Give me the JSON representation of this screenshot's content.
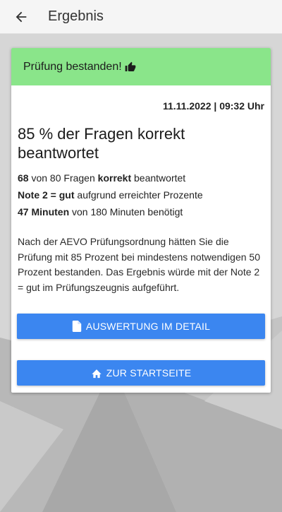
{
  "appbar": {
    "back_icon": "arrow-back-icon",
    "title": "Ergebnis"
  },
  "result": {
    "banner_text": "Prüfung bestanden!",
    "banner_icon": "thumbs-up-icon",
    "banner_color": "#8ae58a",
    "date": "11.11.2022",
    "separator": "|",
    "time": "09:32 Uhr",
    "headline": "85 % der Fragen korrekt beantwortet",
    "stats": {
      "correct_count": "68",
      "correct_mid": "von 80 Fragen",
      "correct_bold": "korrekt",
      "correct_tail": "beantwortet",
      "grade_bold": "Note 2 = gut",
      "grade_tail": "aufgrund erreichter Prozente",
      "minutes_bold": "47 Minuten",
      "minutes_tail": "von 180 Minuten benötigt"
    },
    "description": "Nach der AEVO Prüfungsordnung hätten Sie die Prüfung mit 85 Prozent bei mindestens notwendigen 50 Prozent bestanden. Das Ergebnis würde mit der Note 2 = gut im Prüfungszeugnis aufgeführt."
  },
  "buttons": {
    "detail_label": "AUSWERTUNG IM DETAIL",
    "detail_icon": "document-icon",
    "home_label": "ZUR STARTSEITE",
    "home_icon": "home-icon",
    "color": "#3b86f0"
  }
}
